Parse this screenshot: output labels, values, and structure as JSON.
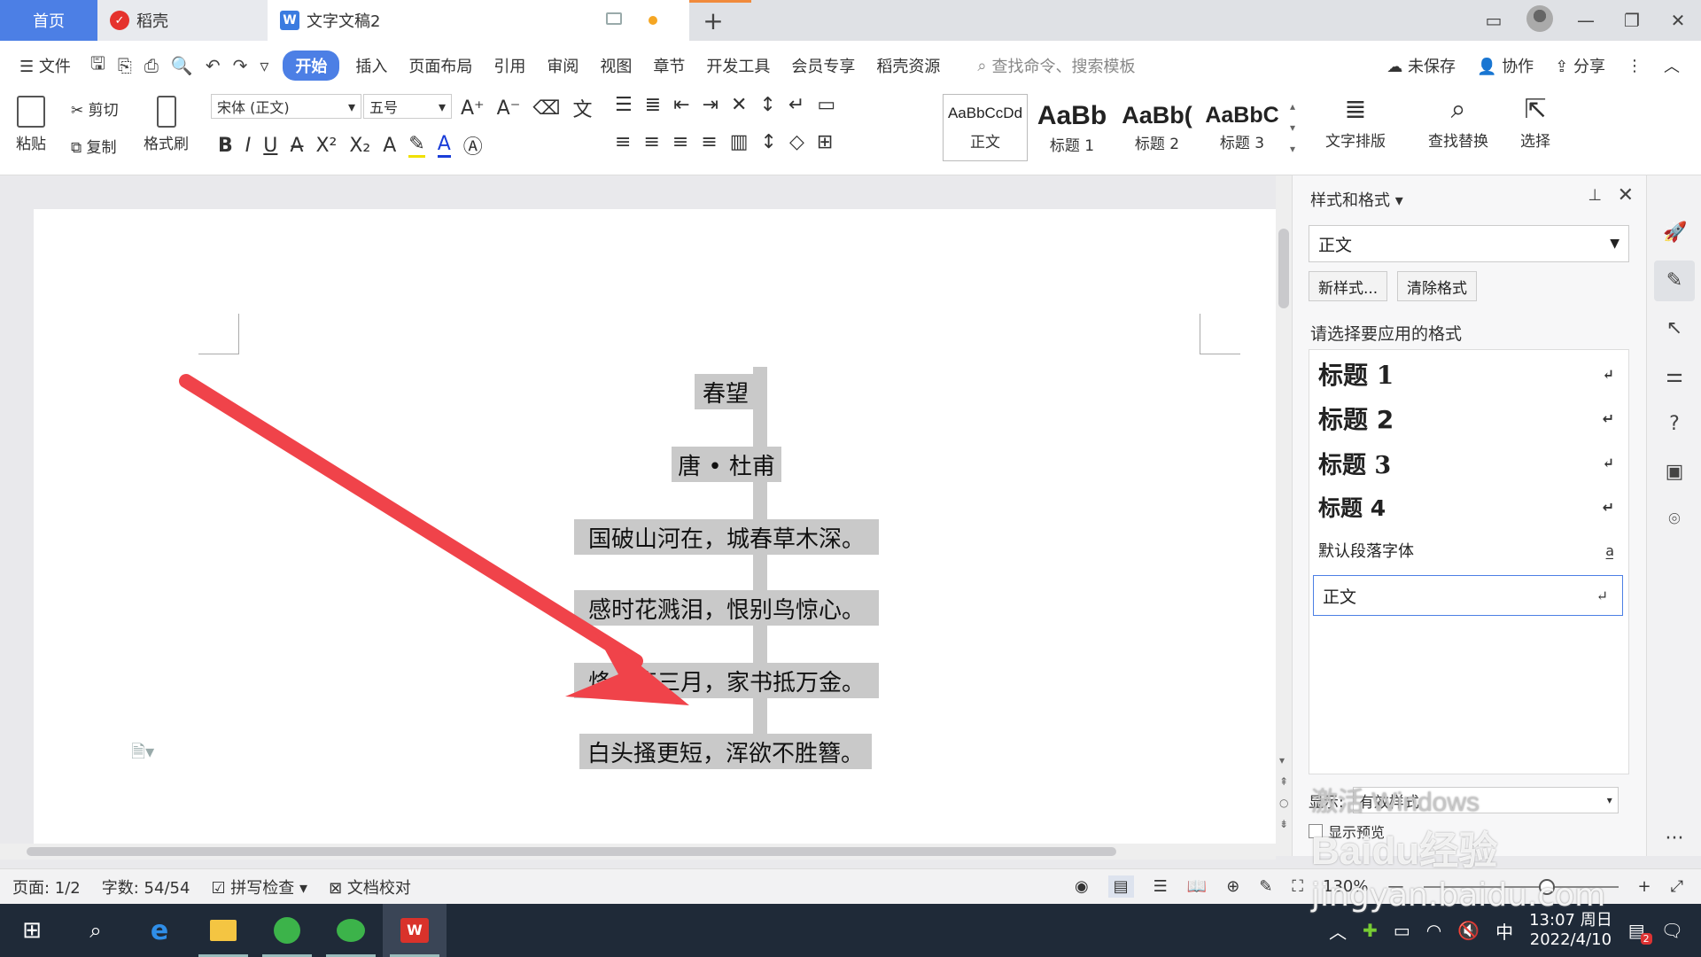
{
  "tabs": {
    "home": "首页",
    "daoke": "稻壳",
    "doc": "文字文稿2"
  },
  "menu": {
    "file": "文件",
    "items": [
      "开始",
      "插入",
      "页面布局",
      "引用",
      "审阅",
      "视图",
      "章节",
      "开发工具",
      "会员专享",
      "稻壳资源"
    ],
    "search": "查找命令、搜索模板",
    "unsaved": "未保存",
    "collab": "协作",
    "share": "分享"
  },
  "ribbon": {
    "paste": "粘贴",
    "cut": "剪切",
    "copy": "复制",
    "format_painter": "格式刷",
    "font_name": "宋体 (正文)",
    "font_size": "五号",
    "styles": [
      {
        "preview": "AaBbCcDd",
        "name": "正文"
      },
      {
        "preview": "AaBb",
        "name": "标题 1"
      },
      {
        "preview": "AaBb(",
        "name": "标题 2"
      },
      {
        "preview": "AaBbC",
        "name": "标题 3"
      }
    ],
    "text_layout": "文字排版",
    "find_replace": "查找替换",
    "select": "选择"
  },
  "document": {
    "lines": [
      "春望",
      "唐 • 杜甫",
      "国破山河在，城春草木深。",
      "感时花溅泪，恨别鸟惊心。",
      "烽火连三月，家书抵万金。",
      "白头搔更短，浑欲不胜簪。"
    ]
  },
  "panel": {
    "title": "样式和格式",
    "current_style": "正文",
    "new_style": "新样式...",
    "clear_format": "清除格式",
    "apply_label": "请选择要应用的格式",
    "styles": [
      {
        "name": "标题  1"
      },
      {
        "name": "标题  2"
      },
      {
        "name": "标题  3"
      },
      {
        "name": "标题  4"
      },
      {
        "name": "默认段落字体"
      },
      {
        "name": "正文"
      }
    ],
    "show_label": "显示:",
    "show_value": "有效样式",
    "preview_label": "显示预览"
  },
  "status": {
    "page": "页面: 1/2",
    "words": "字数: 54/54",
    "spell": "拼写检查",
    "proof": "文档校对",
    "zoom": "130%"
  },
  "taskbar": {
    "ime": "中",
    "time": "13:07 周日",
    "date": "2022/4/10",
    "notif_count": "2"
  },
  "watermark": {
    "activate": "激活 Windows",
    "baidu": "Baidu经验",
    "url": "jingyan.baidu.com"
  },
  "colors": {
    "accent": "#4c7fe5",
    "arrow": "#f0434a",
    "highlight": "#c9c9c9"
  }
}
